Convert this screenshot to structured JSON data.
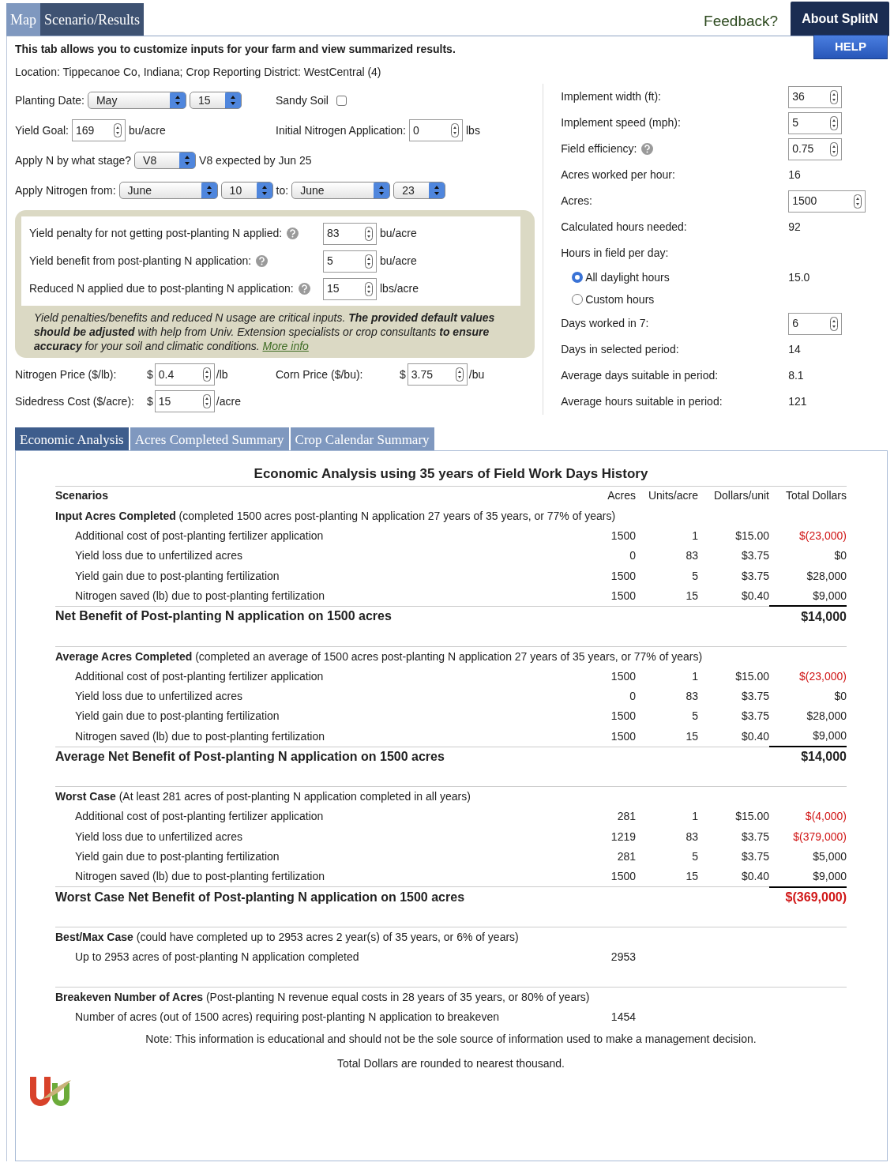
{
  "top_tabs": [
    {
      "label": "Map",
      "selected": false
    },
    {
      "label": "Scenario/Results",
      "selected": true
    }
  ],
  "feedback": "Feedback?",
  "about": "About SplitN",
  "help": "HELP",
  "intro": "This tab allows you to customize inputs for your farm and view summarized results.",
  "location": "Location: Tippecanoe Co, Indiana; Crop Reporting District: WestCentral (4)",
  "form_rows": [
    {
      "left": [
        {
          "kind": "label",
          "text": "Planting Date:"
        },
        {
          "kind": "month",
          "value": "May"
        },
        {
          "kind": "day",
          "value": "15"
        }
      ],
      "right": [
        {
          "kind": "label",
          "text": "Sandy Soil"
        },
        {
          "kind": "checkbox",
          "checked": false
        }
      ]
    },
    {
      "left": [
        {
          "kind": "label",
          "text": "Yield Goal:"
        },
        {
          "kind": "number",
          "value": "169"
        },
        {
          "kind": "text",
          "text": "bu/acre"
        }
      ],
      "right": [
        {
          "kind": "label",
          "text": "Initial Nitrogen Application:"
        },
        {
          "kind": "number",
          "value": "0"
        },
        {
          "kind": "text",
          "text": "lbs"
        }
      ]
    },
    {
      "left": [
        {
          "kind": "label",
          "text": "Apply N by what stage?"
        },
        {
          "kind": "stage",
          "value": "V8"
        },
        {
          "kind": "text",
          "text": "V8 expected by Jun 25"
        }
      ]
    },
    {
      "left": [
        {
          "kind": "label",
          "text": "Apply Nitrogen from:"
        },
        {
          "kind": "month",
          "value": "June"
        },
        {
          "kind": "day",
          "value": "10"
        },
        {
          "kind": "text",
          "text": "to:"
        },
        {
          "kind": "month",
          "value": "June"
        },
        {
          "kind": "day",
          "value": "23"
        }
      ]
    }
  ],
  "penalty_box": {
    "inputs": [
      {
        "label": "Yield penalty for not getting post-planting N applied:",
        "help": true,
        "value": "83",
        "unit": "bu/acre"
      },
      {
        "label": "Yield benefit from post-planting N application:",
        "help": true,
        "value": "5",
        "unit": "bu/acre"
      },
      {
        "label": "Reduced N applied due to post-planting N application:",
        "help": true,
        "value": "15",
        "unit": "lbs/acre"
      }
    ],
    "note": "Yield penalties/benefits and reduced N usage are critical inputs. **The provided default values should be adjusted** with help from Univ. Extension specialists or crop consultants **to ensure accuracy** for your soil and climatic conditions.",
    "link": "More info"
  },
  "price_rows": [
    {
      "left": {
        "label": "Nitrogen Price ($/lb):",
        "prefix": "$",
        "value": "0.4",
        "unit": "/lb"
      },
      "right": {
        "label": "Corn Price ($/bu):",
        "prefix": "$",
        "value": "3.75",
        "unit": "/bu"
      }
    },
    {
      "left": {
        "label": "Sidedress Cost ($/acre):",
        "prefix": "$",
        "value": "15",
        "unit": "/acre"
      }
    }
  ],
  "machine": [
    {
      "kind": "number",
      "label": "Implement width (ft):",
      "value": "36"
    },
    {
      "kind": "number",
      "label": "Implement speed (mph):",
      "value": "5"
    },
    {
      "kind": "number",
      "label": "Field efficiency:",
      "value": "0.75",
      "help": true
    },
    {
      "kind": "value",
      "label": "Acres worked per hour:",
      "value": "16"
    },
    {
      "kind": "wide_number",
      "label": "Acres:",
      "value": "1500"
    },
    {
      "kind": "value",
      "label": "Calculated hours needed:",
      "value": "92"
    },
    {
      "kind": "heading",
      "label": "Hours in field per day:"
    },
    {
      "kind": "radio",
      "label": "All daylight hours",
      "selected": true,
      "value": "15.0"
    },
    {
      "kind": "radio",
      "label": "Custom hours",
      "selected": false
    },
    {
      "kind": "number",
      "label": "Days worked in 7:",
      "value": "6"
    },
    {
      "kind": "value",
      "label": "Days in selected period:",
      "value": "14"
    },
    {
      "kind": "value",
      "label": "Average days suitable in period:",
      "value": "8.1"
    },
    {
      "kind": "value",
      "label": "Average hours suitable in period:",
      "value": "121"
    }
  ],
  "result_tabs": [
    {
      "label": "Economic Analysis",
      "selected": true
    },
    {
      "label": "Acres Completed Summary",
      "selected": false
    },
    {
      "label": "Crop Calendar Summary",
      "selected": false
    }
  ],
  "analysis": {
    "title": "Economic Analysis using 35 years of Field Work Days History",
    "columns": [
      "Scenarios",
      "Acres",
      "Units/acre",
      "Dollars/unit",
      "Total Dollars"
    ],
    "sections": [
      {
        "heading": "**Input Acres Completed** (completed 1500 acres post-planting N application 27 years of 35 years, or 77% of years)",
        "rows": [
          {
            "label": "Additional cost of post-planting fertilizer application",
            "acres": "1500",
            "units": "1",
            "dollars": "$15.00",
            "total": "$(23,000)",
            "negative": true
          },
          {
            "label": "Yield loss due to unfertilized acres",
            "acres": "0",
            "units": "83",
            "dollars": "$3.75",
            "total": "$0",
            "negative": false
          },
          {
            "label": "Yield gain due to post-planting fertilization",
            "acres": "1500",
            "units": "5",
            "dollars": "$3.75",
            "total": "$28,000",
            "negative": false
          },
          {
            "label": "Nitrogen saved (lb) due to post-planting fertilization",
            "acres": "1500",
            "units": "15",
            "dollars": "$0.40",
            "total": "$9,000",
            "negative": false
          }
        ],
        "total": {
          "label": "Net Benefit of Post-planting N application on 1500 acres",
          "value": "$14,000",
          "negative": false
        }
      },
      {
        "heading": "**Average Acres Completed** (completed an average of 1500 acres post-planting N application 27 years of 35 years, or 77% of years)",
        "rows": [
          {
            "label": "Additional cost of post-planting fertilizer application",
            "acres": "1500",
            "units": "1",
            "dollars": "$15.00",
            "total": "$(23,000)",
            "negative": true
          },
          {
            "label": "Yield loss due to unfertilized acres",
            "acres": "0",
            "units": "83",
            "dollars": "$3.75",
            "total": "$0",
            "negative": false
          },
          {
            "label": "Yield gain due to post-planting fertilization",
            "acres": "1500",
            "units": "5",
            "dollars": "$3.75",
            "total": "$28,000",
            "negative": false
          },
          {
            "label": "Nitrogen saved (lb) due to post-planting fertilization",
            "acres": "1500",
            "units": "15",
            "dollars": "$0.40",
            "total": "$9,000",
            "negative": false
          }
        ],
        "total": {
          "label": "Average Net Benefit of Post-planting N application on 1500 acres",
          "value": "$14,000",
          "negative": false
        }
      },
      {
        "heading": "**Worst Case** (At least 281 acres of post-planting N application completed in all years)",
        "rows": [
          {
            "label": "Additional cost of post-planting fertilizer application",
            "acres": "281",
            "units": "1",
            "dollars": "$15.00",
            "total": "$(4,000)",
            "negative": true
          },
          {
            "label": "Yield loss due to unfertilized acres",
            "acres": "1219",
            "units": "83",
            "dollars": "$3.75",
            "total": "$(379,000)",
            "negative": true
          },
          {
            "label": "Yield gain due to post-planting fertilization",
            "acres": "281",
            "units": "5",
            "dollars": "$3.75",
            "total": "$5,000",
            "negative": false
          },
          {
            "label": "Nitrogen saved (lb) due to post-planting fertilization",
            "acres": "1500",
            "units": "15",
            "dollars": "$0.40",
            "total": "$9,000",
            "negative": false
          }
        ],
        "total": {
          "label": "Worst Case Net Benefit of Post-planting N application on 1500 acres",
          "value": "$(369,000)",
          "negative": true
        }
      },
      {
        "heading": "**Best/Max Case** (could have completed up to 2953 acres 2 year(s) of 35 years, or 6% of years)",
        "rows": [
          {
            "label": "Up to 2953 acres of post-planting N application completed",
            "acres": "2953"
          }
        ]
      },
      {
        "heading": "**Breakeven Number of Acres** (Post-planting N revenue equal costs in 28 years of 35 years, or 80% of years)",
        "rows": [
          {
            "label": "Number of acres (out of 1500 acres) requiring post-planting N application to breakeven",
            "acres": "1454"
          }
        ]
      }
    ]
  },
  "notes": [
    "Note: This information is educational and should not be the sole source of information used to make a management decision.",
    "Total Dollars are rounded to nearest thousand."
  ]
}
